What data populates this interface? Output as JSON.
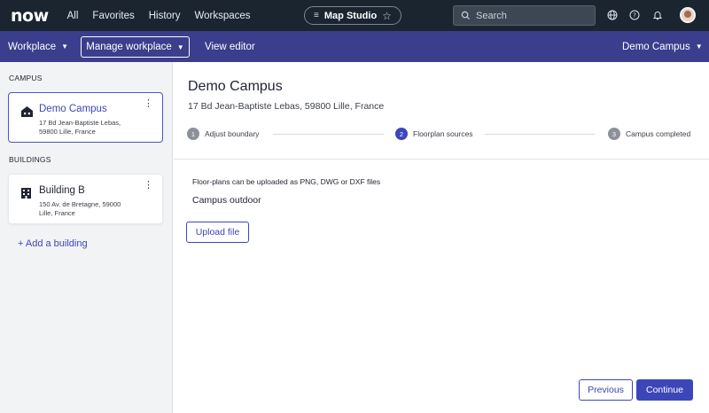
{
  "topnav": {
    "logo": "now",
    "items": [
      "All",
      "Favorites",
      "History",
      "Workspaces"
    ],
    "app_pill": {
      "label": "Map Studio",
      "menu_icon": "≡",
      "star_icon": "☆"
    },
    "search": {
      "placeholder": "Search",
      "icon": "⌕"
    },
    "icons": {
      "globe": "⊕",
      "help": "?",
      "bell": "🔔"
    }
  },
  "subbar": {
    "workplace": "Workplace",
    "manage_workplace": "Manage workplace",
    "view_editor": "View editor",
    "campus_select": "Demo Campus",
    "caret": "▼"
  },
  "sidebar": {
    "campus_label": "CAMPUS",
    "campus": {
      "name": "Demo Campus",
      "address": "17 Bd Jean-Baptiste Lebas, 59800 Lille, France"
    },
    "buildings_label": "BUILDINGS",
    "buildings": [
      {
        "name": "Building B",
        "address": "150 Av. de Bretagne, 59000 Lille, France"
      }
    ],
    "add_building": "+ Add a building",
    "kebab": "⋮"
  },
  "main": {
    "title": "Demo Campus",
    "address": "17 Bd Jean-Baptiste Lebas, 59800 Lille, France",
    "steps": [
      {
        "num": "1",
        "label": "Adjust boundary"
      },
      {
        "num": "2",
        "label": "Floorplan sources"
      },
      {
        "num": "3",
        "label": "Campus completed"
      }
    ],
    "hint": "Floor-plans can be uploaded as PNG, DWG or DXF files",
    "outdoor_label": "Campus outdoor",
    "upload_button": "Upload file",
    "previous_button": "Previous",
    "continue_button": "Continue"
  },
  "colors": {
    "accent": "#3c46b8",
    "topbar": "#1b2530",
    "subbar": "#3a3e8c"
  }
}
